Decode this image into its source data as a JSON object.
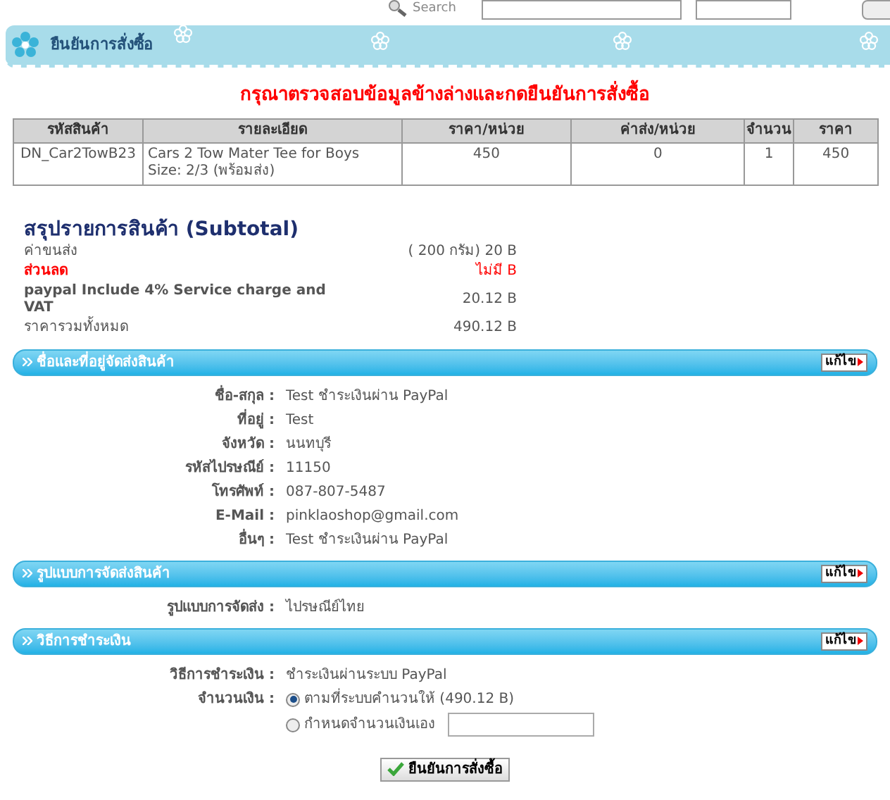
{
  "top_search": {
    "label": "Search"
  },
  "banner": {
    "title": "ยืนยันการสั่งซื้อ"
  },
  "notice": "กรุณาตรวจสอบข้อมูลข้างล่างและกดยืนยันการสั่งซื้อ",
  "order_table": {
    "columns": [
      "รหัสสินค้า",
      "รายละเอียด",
      "ราคา/หน่วย",
      "ค่าส่ง/หน่วย",
      "จำนวน",
      "ราคา"
    ],
    "rows": [
      [
        "DN_Car2TowB23",
        "Cars 2 Tow Mater Tee for Boys Size: 2/3 (พร้อมส่ง)",
        "450",
        "0",
        "1",
        "450"
      ]
    ]
  },
  "subtotal": {
    "title": "สรุปรายการสินค้า (Subtotal)",
    "rows": [
      {
        "kind": "normal",
        "label": "ค่าขนส่ง",
        "value": "( 200 กรัม) 20 B"
      },
      {
        "kind": "discount",
        "label": "ส่วนลด",
        "value": "ไม่มี B"
      },
      {
        "kind": "bold",
        "label": "paypal Include 4% Service charge and VAT",
        "value": "20.12 B"
      },
      {
        "kind": "normal",
        "label": "ราคารวมทั้งหมด",
        "value": "490.12 B"
      }
    ]
  },
  "sections": [
    {
      "title": "ชื่อและที่อยู่จัดส่งสินค้า",
      "edit_label": "แก้ไข",
      "fields": [
        {
          "kind": "text",
          "label": "ชื่อ-สกุล :",
          "value": "Test ชำระเงินผ่าน PayPal"
        },
        {
          "kind": "text",
          "label": "ที่อยู่ :",
          "value": "Test"
        },
        {
          "kind": "text",
          "label": "จังหวัด :",
          "value": "นนทบุรี"
        },
        {
          "kind": "text",
          "label": "รหัสไปรษณีย์ :",
          "value": "11150"
        },
        {
          "kind": "text",
          "label": "โทรศัพท์ :",
          "value": "087-807-5487"
        },
        {
          "kind": "text",
          "label": "E-Mail :",
          "value": "pinklaoshop@gmail.com"
        },
        {
          "kind": "text",
          "label": "อื่นๆ :",
          "value": "Test ชำระเงินผ่าน PayPal"
        }
      ]
    },
    {
      "title": "รูปแบบการจัดส่งสินค้า",
      "edit_label": "แก้ไข",
      "fields": [
        {
          "kind": "text",
          "label": "รูปแบบการจัดส่ง :",
          "value": "ไปรษณีย์ไทย"
        }
      ]
    },
    {
      "title": "วิธีการชำระเงิน",
      "edit_label": "แก้ไข",
      "fields": [
        {
          "kind": "text",
          "label": "วิธีการชำระเงิน :",
          "value": "ชำระเงินผ่านระบบ PayPal"
        },
        {
          "kind": "radio_group",
          "label": "จำนวนเงิน :",
          "options": [
            {
              "label": "ตามที่ระบบคำนวนให้ (490.12 B)",
              "selected": true,
              "has_input": false
            },
            {
              "label": "กำหนดจำนวนเงินเอง",
              "selected": false,
              "has_input": true
            }
          ]
        }
      ]
    }
  ],
  "confirm_button": "ยืนยันการสั่งซื้อ"
}
